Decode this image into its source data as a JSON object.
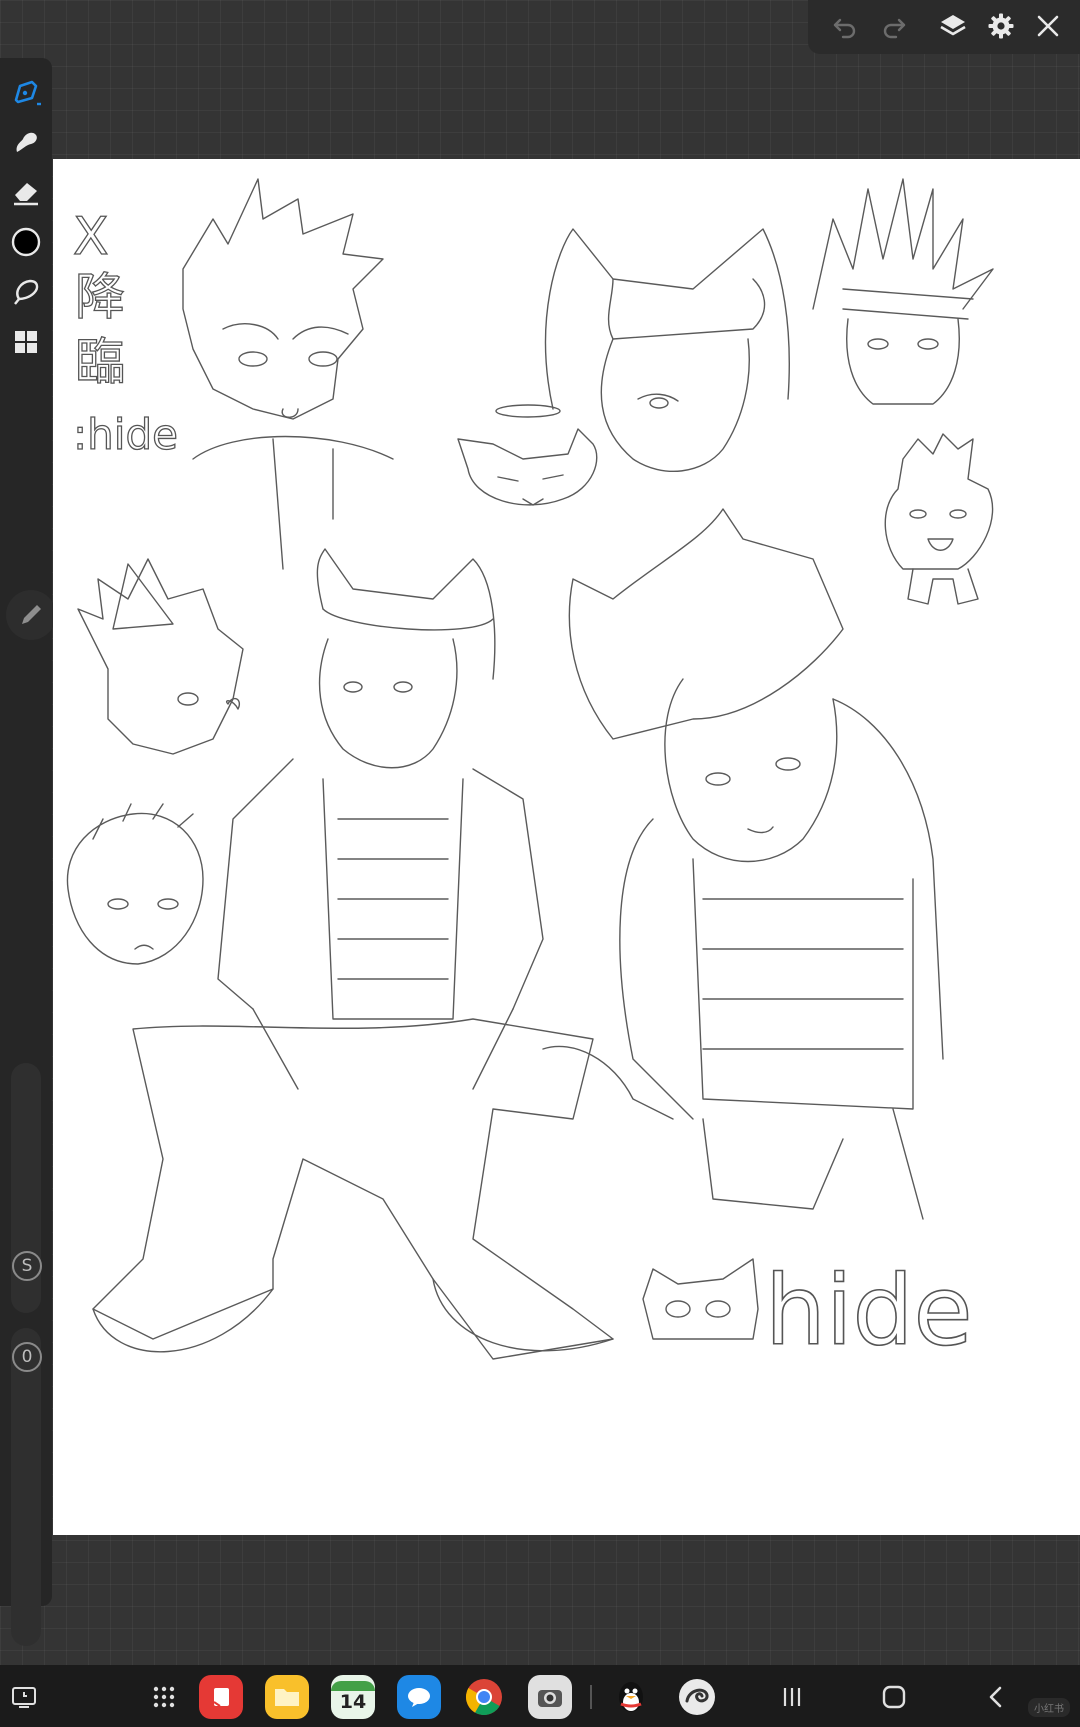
{
  "toolbar_top": {
    "undo": "undo-icon",
    "redo": "redo-icon",
    "layers": "layers-icon",
    "settings": "gear-icon",
    "close": "close-icon"
  },
  "tools": [
    {
      "name": "brush-tool",
      "icon": "pen-nib-icon",
      "active": true
    },
    {
      "name": "smudge-tool",
      "icon": "smudge-icon",
      "active": false
    },
    {
      "name": "eraser-tool",
      "icon": "eraser-icon",
      "active": false
    },
    {
      "name": "color-picker",
      "icon": "color-circle-icon",
      "active": false
    },
    {
      "name": "selection-tool",
      "icon": "lasso-icon",
      "active": false
    },
    {
      "name": "gallery",
      "icon": "grid-icon",
      "active": false
    }
  ],
  "sliders": {
    "size_label": "S",
    "opacity_label": "0"
  },
  "canvas": {
    "text_x": "X",
    "text_kanji_1": "降",
    "text_kanji_2": "臨",
    "text_hide_small": ":hide",
    "text_hide_large": "hide"
  },
  "taskbar": {
    "calendar_date": "14",
    "watermark": "小红书"
  },
  "colors": {
    "accent": "#1e88e5",
    "background": "#343434",
    "canvas": "#ffffff"
  }
}
